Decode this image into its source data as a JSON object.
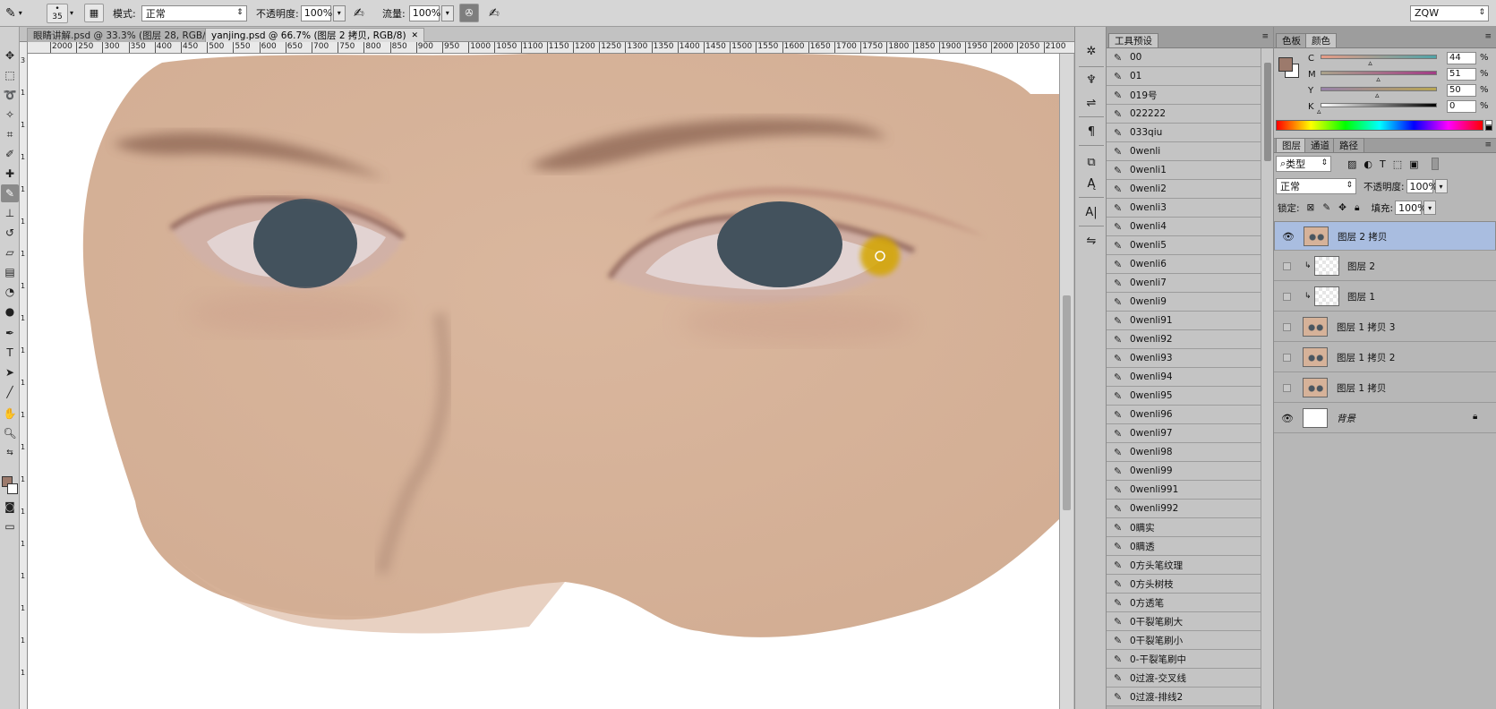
{
  "options_bar": {
    "brush_size": "35",
    "mode_label": "模式:",
    "mode_value": "正常",
    "opacity_label": "不透明度:",
    "opacity_value": "100%",
    "flow_label": "流量:",
    "flow_value": "100%",
    "workspace": "ZQW"
  },
  "document_tabs": [
    {
      "label": "眼睛讲解.psd @ 33.3% (图层 28, RGB/8)",
      "active": false
    },
    {
      "label": "yanjing.psd @ 66.7% (图层 2 拷贝, RGB/8)",
      "active": true
    }
  ],
  "ruler_top": [
    "2000",
    "250",
    "300",
    "350",
    "400",
    "450",
    "500",
    "550",
    "600",
    "650",
    "700",
    "750",
    "800",
    "850",
    "900",
    "950",
    "1000",
    "1050",
    "1100",
    "1150",
    "1200",
    "1250",
    "1300",
    "1350",
    "1400",
    "1450",
    "1500",
    "1550",
    "1600",
    "1650",
    "1700",
    "1750",
    "1800",
    "1850",
    "1900",
    "1950",
    "2000",
    "2050",
    "2100"
  ],
  "ruler_left": [
    "3",
    "1",
    "1",
    "1",
    "1",
    "1",
    "1",
    "1",
    "1",
    "1",
    "1",
    "1",
    "1",
    "1",
    "1",
    "1",
    "1",
    "1",
    "1",
    "1"
  ],
  "tool_presets": {
    "tab": "工具预设",
    "items": [
      "00",
      "01",
      "019号",
      "022222",
      "033qiu",
      "0wenli",
      "0wenli1",
      "0wenli2",
      "0wenli3",
      "0wenli4",
      "0wenli5",
      "0wenli6",
      "0wenli7",
      "0wenli9",
      "0wenli91",
      "0wenli92",
      "0wenli93",
      "0wenli94",
      "0wenli95",
      "0wenli96",
      "0wenli97",
      "0wenli98",
      "0wenli99",
      "0wenli991",
      "0wenli992",
      "0瞒实",
      "0瞒透",
      "0方头笔纹理",
      "0方头树枝",
      "0方透笔",
      "0干裂笔刷大",
      "0干裂笔刷小",
      "0-干裂笔刷中",
      "0过渡-交叉线",
      "0过渡-排线2"
    ]
  },
  "color_panel": {
    "tabs": [
      "色板",
      "颜色"
    ],
    "active_tab": "颜色",
    "channels": [
      {
        "label": "C",
        "value": "44"
      },
      {
        "label": "M",
        "value": "51"
      },
      {
        "label": "Y",
        "value": "50"
      },
      {
        "label": "K",
        "value": "0"
      }
    ],
    "pct": "%",
    "foreground": "#9c7a6c"
  },
  "layers_panel": {
    "tabs": [
      "图层",
      "通道",
      "路径"
    ],
    "active_tab": "图层",
    "filter_kind": "类型",
    "blend_mode": "正常",
    "opacity_label": "不透明度:",
    "opacity_value": "100%",
    "lock_label": "锁定:",
    "fill_label": "填充:",
    "fill_value": "100%",
    "layers": [
      {
        "name": "图层 2 拷贝",
        "visible": true,
        "selected": true
      },
      {
        "name": "图层 2",
        "visible": false,
        "selected": false
      },
      {
        "name": "图层 1",
        "visible": false,
        "selected": false
      },
      {
        "name": "图层 1 拷贝 3",
        "visible": false,
        "selected": false
      },
      {
        "name": "图层 1 拷贝 2",
        "visible": false,
        "selected": false
      },
      {
        "name": "图层 1 拷贝",
        "visible": false,
        "selected": false
      },
      {
        "name": "背景",
        "visible": true,
        "selected": false
      }
    ]
  },
  "colors": {
    "skin": "#d6b299",
    "iris": "#43525d",
    "brush_highlight": "#d4a600"
  }
}
